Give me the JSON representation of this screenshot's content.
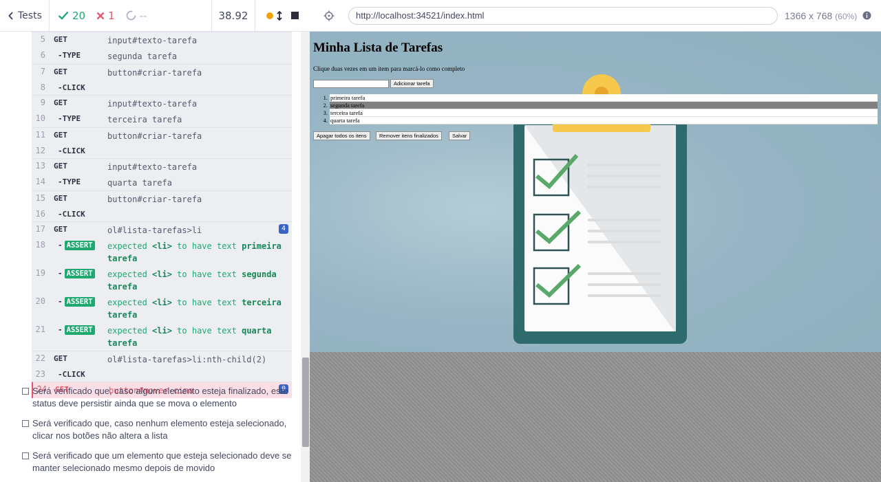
{
  "topbar": {
    "tests_label": "Tests",
    "passed": "20",
    "failed": "1",
    "pending": "--",
    "duration": "38.92"
  },
  "urlbar": {
    "url": "http://localhost:34521/index.html",
    "viewport": "1366 x 768",
    "scale": "(60%)"
  },
  "commands": [
    {
      "num": "5",
      "name": "GET",
      "child": false,
      "msg": "input#texto-tarefa"
    },
    {
      "num": "6",
      "name": "-TYPE",
      "child": true,
      "msg": "segunda tarefa"
    },
    {
      "num": "7",
      "name": "GET",
      "child": false,
      "msg": "button#criar-tarefa"
    },
    {
      "num": "8",
      "name": "-CLICK",
      "child": true,
      "msg": ""
    },
    {
      "num": "9",
      "name": "GET",
      "child": false,
      "msg": "input#texto-tarefa"
    },
    {
      "num": "10",
      "name": "-TYPE",
      "child": true,
      "msg": "terceira tarefa"
    },
    {
      "num": "11",
      "name": "GET",
      "child": false,
      "msg": "button#criar-tarefa"
    },
    {
      "num": "12",
      "name": "-CLICK",
      "child": true,
      "msg": ""
    },
    {
      "num": "13",
      "name": "GET",
      "child": false,
      "msg": "input#texto-tarefa"
    },
    {
      "num": "14",
      "name": "-TYPE",
      "child": true,
      "msg": "quarta tarefa"
    },
    {
      "num": "15",
      "name": "GET",
      "child": false,
      "msg": "button#criar-tarefa"
    },
    {
      "num": "16",
      "name": "-CLICK",
      "child": true,
      "msg": ""
    },
    {
      "num": "17",
      "name": "GET",
      "child": false,
      "msg": "ol#lista-tarefas>li",
      "badge": "4"
    }
  ],
  "asserts": [
    {
      "num": "18",
      "prefix": "expected",
      "tag": "<li>",
      "mid": "to have text",
      "value": "primeira tarefa"
    },
    {
      "num": "19",
      "prefix": "expected",
      "tag": "<li>",
      "mid": "to have text",
      "value": "segunda tarefa"
    },
    {
      "num": "20",
      "prefix": "expected",
      "tag": "<li>",
      "mid": "to have text",
      "value": "terceira tarefa"
    },
    {
      "num": "21",
      "prefix": "expected",
      "tag": "<li>",
      "mid": "to have text",
      "value": "quarta tarefa"
    }
  ],
  "assert_label": "ASSERT",
  "commands_after": [
    {
      "num": "22",
      "name": "GET",
      "child": false,
      "msg": "ol#lista-tarefas>li:nth-child(2)"
    },
    {
      "num": "23",
      "name": "-CLICK",
      "child": true,
      "msg": ""
    }
  ],
  "failed_command": {
    "num": "24",
    "name": "GET",
    "msg": "button#mover-cima",
    "badge": "0"
  },
  "tests": [
    "Será verificado que, caso algum elemento esteja finalizado, este status deve persistir ainda que se mova o elemento",
    "Será verificado que, caso nenhum elemento esteja selecionado, clicar nos botões não altera a lista",
    "Será verificado que um elemento que esteja selecionado deve se manter selecionado mesmo depois de movido"
  ],
  "app": {
    "title": "Minha Lista de Tarefas",
    "instructions": "Clique duas vezes em um item para marcá-lo como completo",
    "add_button": "Adicionar tarefa",
    "items": [
      "primeira tarefa",
      "segunda tarefa",
      "terceira tarefa",
      "quarta tarefa"
    ],
    "selected_index": 1,
    "clear_all_button": "Apagar todos os itens",
    "remove_done_button": "Remover itens finalizados",
    "save_button": "Salvar"
  },
  "colors": {
    "pass": "#1fa971",
    "fail": "#e45770",
    "badge": "#3b63c7",
    "selected": "#808080"
  }
}
